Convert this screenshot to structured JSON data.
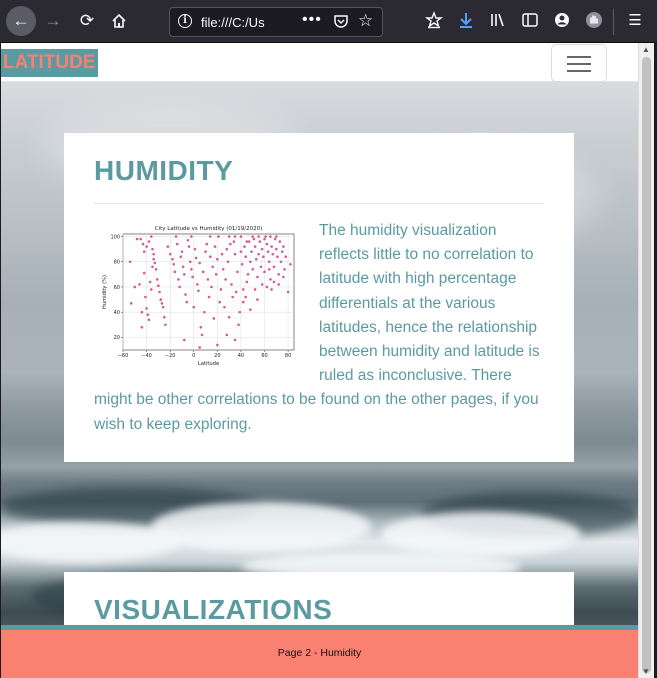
{
  "browser": {
    "url": "file:///C:/Us",
    "page_actions": "•••"
  },
  "navbar": {
    "brand": "LATITUDE"
  },
  "card": {
    "title": "HUMIDITY",
    "body": "The humidity visualization reflects little to no correlation to latitude with high percentage differentials at the various latitudes, hence the relationship between humidity and latitude is ruled as inconclusive. There might be other correlations to be found on the other pages, if you wish to keep exploring."
  },
  "card2": {
    "title": "VISUALIZATIONS"
  },
  "footer": {
    "text": "Page 2 - Humidity"
  },
  "colors": {
    "accent": "#5b9aa0",
    "salmon": "#fa8072",
    "point": "#d65b8f"
  },
  "chart_data": {
    "type": "scatter",
    "title": "City Latitude vs Humidity (01/19/2020)",
    "xlabel": "Latitude",
    "ylabel": "Humidity (%)",
    "xlim": [
      -60,
      85
    ],
    "ylim": [
      10,
      102
    ],
    "x_ticks": [
      "−60",
      "−40",
      "−20",
      "0",
      "20",
      "40",
      "60",
      "80"
    ],
    "y_ticks": [
      "20",
      "40",
      "60",
      "80",
      "100"
    ],
    "grid": true,
    "points": [
      [
        -45,
        98
      ],
      [
        -43,
        94
      ],
      [
        -42,
        88
      ],
      [
        -40,
        92
      ],
      [
        -38,
        96
      ],
      [
        -36,
        100
      ],
      [
        -35,
        90
      ],
      [
        -34,
        86
      ],
      [
        -33,
        79
      ],
      [
        -32,
        74
      ],
      [
        -31,
        66
      ],
      [
        -30,
        61
      ],
      [
        -29,
        56
      ],
      [
        -28,
        50
      ],
      [
        -27,
        47
      ],
      [
        -26,
        44
      ],
      [
        -25,
        36
      ],
      [
        -24,
        30
      ],
      [
        -42,
        71
      ],
      [
        -41,
        52
      ],
      [
        -40,
        43
      ],
      [
        -39,
        38
      ],
      [
        -38,
        34
      ],
      [
        -37,
        64
      ],
      [
        -36,
        58
      ],
      [
        -35,
        76
      ],
      [
        -34,
        82
      ],
      [
        -54,
        80
      ],
      [
        -53,
        47
      ],
      [
        -50,
        60
      ],
      [
        -48,
        98
      ],
      [
        -46,
        62
      ],
      [
        -44,
        40
      ],
      [
        -44,
        28
      ],
      [
        -22,
        92
      ],
      [
        -20,
        86
      ],
      [
        -18,
        82
      ],
      [
        -17,
        78
      ],
      [
        -16,
        72
      ],
      [
        -15,
        100
      ],
      [
        -14,
        94
      ],
      [
        -13,
        66
      ],
      [
        -12,
        60
      ],
      [
        -11,
        84
      ],
      [
        -10,
        88
      ],
      [
        -9,
        76
      ],
      [
        -8,
        70
      ],
      [
        -7,
        54
      ],
      [
        -6,
        48
      ],
      [
        -5,
        97
      ],
      [
        -4,
        92
      ],
      [
        -3,
        80
      ],
      [
        -2,
        74
      ],
      [
        -1,
        68
      ],
      [
        0,
        44
      ],
      [
        1,
        90
      ],
      [
        2,
        83
      ],
      [
        3,
        62
      ],
      [
        4,
        57
      ],
      [
        5,
        79
      ],
      [
        6,
        28
      ],
      [
        7,
        22
      ],
      [
        8,
        72
      ],
      [
        9,
        40
      ],
      [
        10,
        88
      ],
      [
        11,
        94
      ],
      [
        12,
        66
      ],
      [
        13,
        52
      ],
      [
        14,
        84
      ],
      [
        15,
        60
      ],
      [
        16,
        76
      ],
      [
        17,
        35
      ],
      [
        18,
        92
      ],
      [
        19,
        70
      ],
      [
        20,
        82
      ],
      [
        21,
        100
      ],
      [
        22,
        48
      ],
      [
        23,
        58
      ],
      [
        24,
        86
      ],
      [
        25,
        74
      ],
      [
        26,
        44
      ],
      [
        27,
        66
      ],
      [
        28,
        90
      ],
      [
        29,
        80
      ],
      [
        30,
        36
      ],
      [
        31,
        94
      ],
      [
        32,
        62
      ],
      [
        33,
        52
      ],
      [
        34,
        96
      ],
      [
        35,
        86
      ],
      [
        36,
        56
      ],
      [
        37,
        72
      ],
      [
        38,
        30
      ],
      [
        39,
        40
      ],
      [
        40,
        88
      ],
      [
        41,
        78
      ],
      [
        42,
        48
      ],
      [
        43,
        92
      ],
      [
        44,
        84
      ],
      [
        45,
        64
      ],
      [
        46,
        70
      ],
      [
        47,
        96
      ],
      [
        48,
        80
      ],
      [
        49,
        88
      ],
      [
        50,
        74
      ],
      [
        51,
        98
      ],
      [
        52,
        92
      ],
      [
        53,
        82
      ],
      [
        54,
        68
      ],
      [
        55,
        86
      ],
      [
        56,
        96
      ],
      [
        57,
        76
      ],
      [
        58,
        90
      ],
      [
        59,
        84
      ],
      [
        60,
        72
      ],
      [
        61,
        100
      ],
      [
        62,
        94
      ],
      [
        63,
        88
      ],
      [
        64,
        80
      ],
      [
        65,
        66
      ],
      [
        66,
        92
      ],
      [
        67,
        86
      ],
      [
        68,
        76
      ],
      [
        69,
        98
      ],
      [
        70,
        90
      ],
      [
        71,
        84
      ],
      [
        72,
        70
      ],
      [
        73,
        96
      ],
      [
        74,
        80
      ],
      [
        75,
        88
      ],
      [
        76,
        92
      ],
      [
        77,
        74
      ],
      [
        78,
        84
      ],
      [
        80,
        56
      ],
      [
        82,
        78
      ],
      [
        45,
        96
      ],
      [
        50,
        100
      ],
      [
        55,
        100
      ],
      [
        60,
        98
      ],
      [
        65,
        100
      ],
      [
        70,
        100
      ],
      [
        35,
        100
      ],
      [
        40,
        100
      ],
      [
        -2,
        100
      ],
      [
        14,
        100
      ],
      [
        30,
        100
      ],
      [
        62,
        60
      ],
      [
        66,
        58
      ],
      [
        68,
        64
      ],
      [
        42,
        58
      ],
      [
        20,
        14
      ],
      [
        28,
        22
      ],
      [
        35,
        18
      ],
      [
        -8,
        18
      ],
      [
        5,
        12
      ],
      [
        48,
        42
      ],
      [
        44,
        52
      ],
      [
        58,
        62
      ],
      [
        52,
        58
      ],
      [
        54,
        50
      ],
      [
        64,
        74
      ],
      [
        72,
        62
      ],
      [
        76,
        68
      ]
    ]
  }
}
